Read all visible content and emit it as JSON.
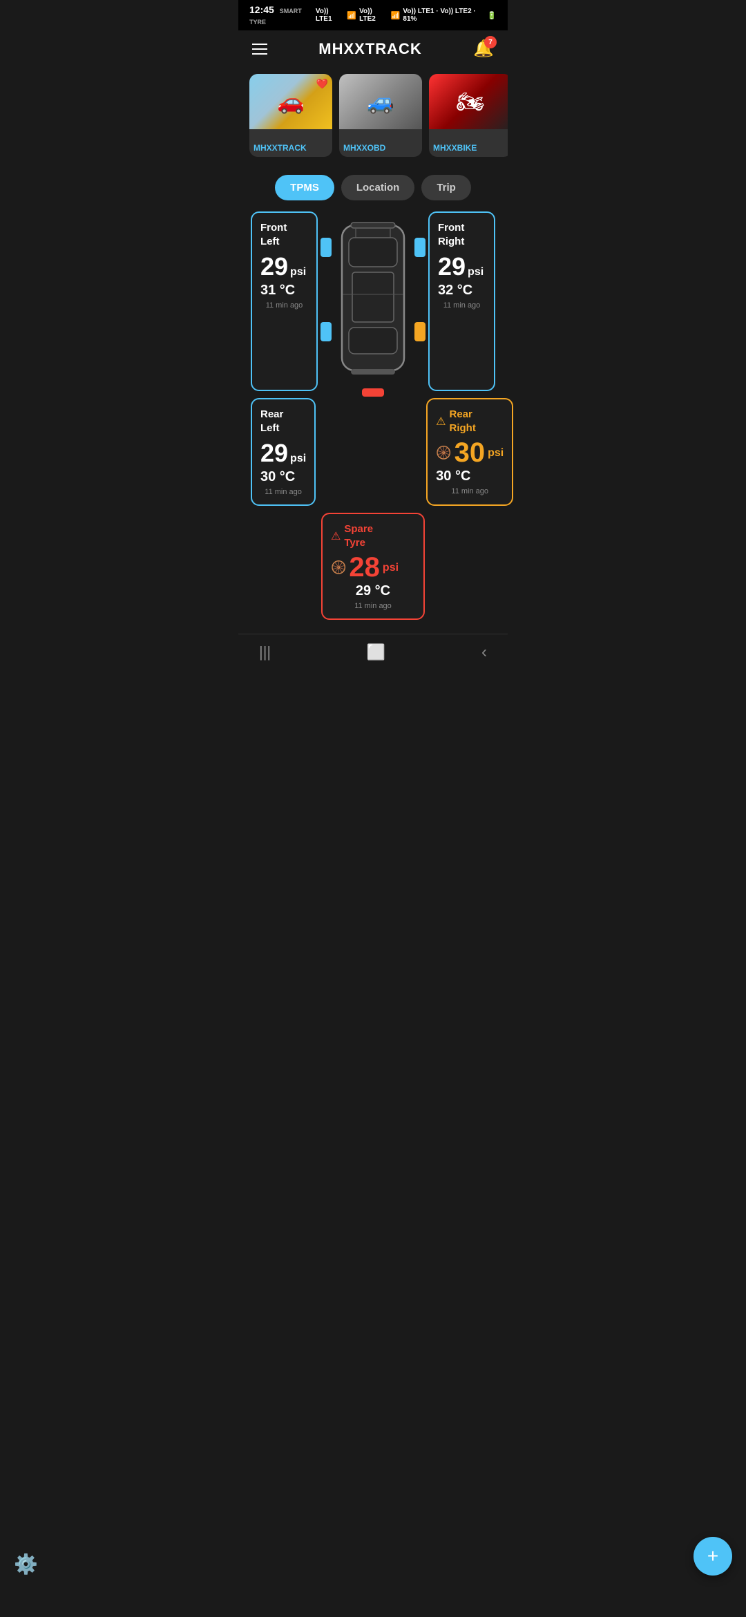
{
  "statusBar": {
    "time": "12:45",
    "smartTyre": "SMART TYRE",
    "signal": "Vo)) LTE1 · Vo)) LTE2 · 81%"
  },
  "header": {
    "title": "MHXXTRACK",
    "notificationCount": "7"
  },
  "vehicles": [
    {
      "id": "v1",
      "name": "MHXXTRACK",
      "emoji": "🚗",
      "bgClass": "car1-bg",
      "hasHeart": true
    },
    {
      "id": "v2",
      "name": "MHXXOBD",
      "emoji": "🚙",
      "bgClass": "car2-bg",
      "hasHeart": false
    },
    {
      "id": "v3",
      "name": "MHXXBIKE",
      "emoji": "🏍",
      "bgClass": "car3-bg",
      "hasHeart": false
    }
  ],
  "tabs": [
    {
      "id": "tpms",
      "label": "TPMS",
      "active": true
    },
    {
      "id": "location",
      "label": "Location",
      "active": false
    },
    {
      "id": "trip",
      "label": "Trip",
      "active": false
    }
  ],
  "tpms": {
    "frontLeft": {
      "position": "Front\nLeft",
      "psi": "29",
      "psiUnit": "psi",
      "temp": "31 °C",
      "time": "11 min ago",
      "status": "normal"
    },
    "frontRight": {
      "position": "Front\nRight",
      "psi": "29",
      "psiUnit": "psi",
      "temp": "32 °C",
      "time": "11 min ago",
      "status": "normal"
    },
    "rearLeft": {
      "position": "Rear\nLeft",
      "psi": "29",
      "psiUnit": "psi",
      "temp": "30 °C",
      "time": "11 min ago",
      "status": "normal"
    },
    "rearRight": {
      "position": "Rear\nRight",
      "psi": "30",
      "psiUnit": "psi",
      "temp": "30 °C",
      "time": "11 min ago",
      "status": "warning-yellow"
    },
    "spare": {
      "position": "Spare\nTyre",
      "psi": "28",
      "psiUnit": "psi",
      "temp": "29 °C",
      "time": "11 min ago",
      "status": "warning-red"
    }
  },
  "fab": {
    "label": "+"
  },
  "bottomNav": {
    "menu": "|||",
    "home": "⬜",
    "back": "‹"
  }
}
